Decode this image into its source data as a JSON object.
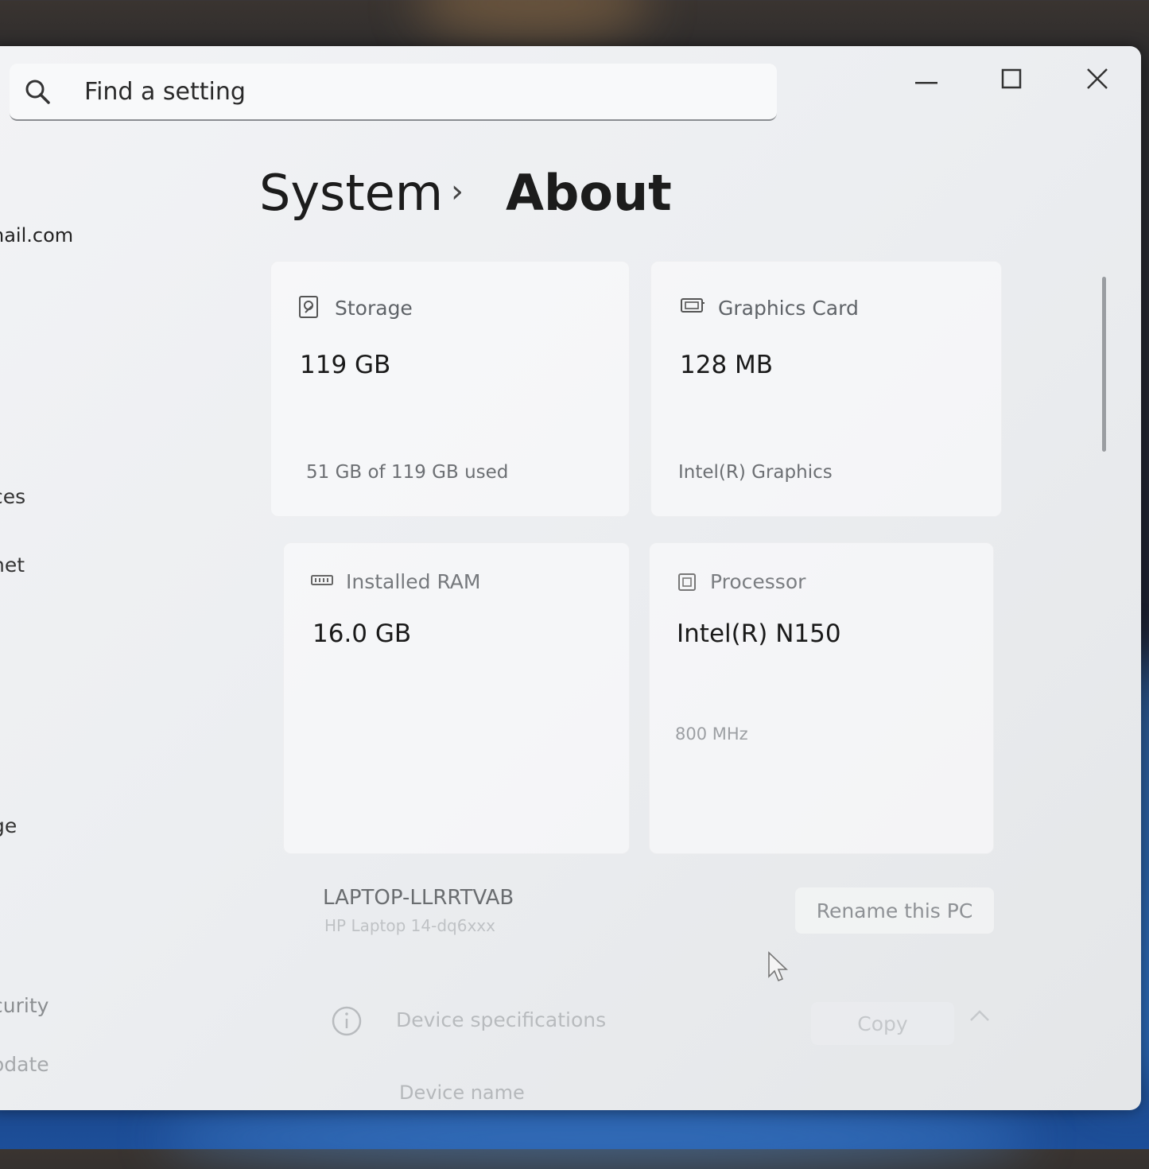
{
  "search": {
    "placeholder": "Find a setting"
  },
  "breadcrumb": {
    "parent": "System",
    "current": "About"
  },
  "account": {
    "email_fragment": "nail.com"
  },
  "sidebar": {
    "items": [
      {
        "label": "ces"
      },
      {
        "label": "net"
      },
      {
        "label": "ge"
      },
      {
        "label": "curity"
      },
      {
        "label": "odate"
      }
    ]
  },
  "specs": {
    "storage": {
      "title": "Storage",
      "value": "119 GB",
      "detail": "51 GB of 119 GB used"
    },
    "graphics": {
      "title": "Graphics Card",
      "value": "128 MB",
      "detail": "Intel(R) Graphics"
    },
    "ram": {
      "title": "Installed RAM",
      "value": "16.0 GB"
    },
    "processor": {
      "title": "Processor",
      "value": "Intel(R) N150",
      "detail": "800 MHz"
    }
  },
  "device": {
    "name": "LAPTOP-LLRRTVAB",
    "model": "HP Laptop 14-dq6xxx",
    "rename_label": "Rename this PC"
  },
  "device_specs": {
    "title": "Device specifications",
    "copy_label": "Copy",
    "first_field_label": "Device name"
  },
  "icons": {
    "search": "search-icon",
    "minimize": "minimize-icon",
    "maximize": "maximize-icon",
    "close": "close-icon",
    "storage": "storage-drive-icon",
    "graphics": "graphics-card-icon",
    "ram": "ram-icon",
    "processor": "processor-chip-icon",
    "info": "info-icon",
    "collapse": "chevron-up-icon",
    "cursor": "mouse-pointer-icon"
  }
}
